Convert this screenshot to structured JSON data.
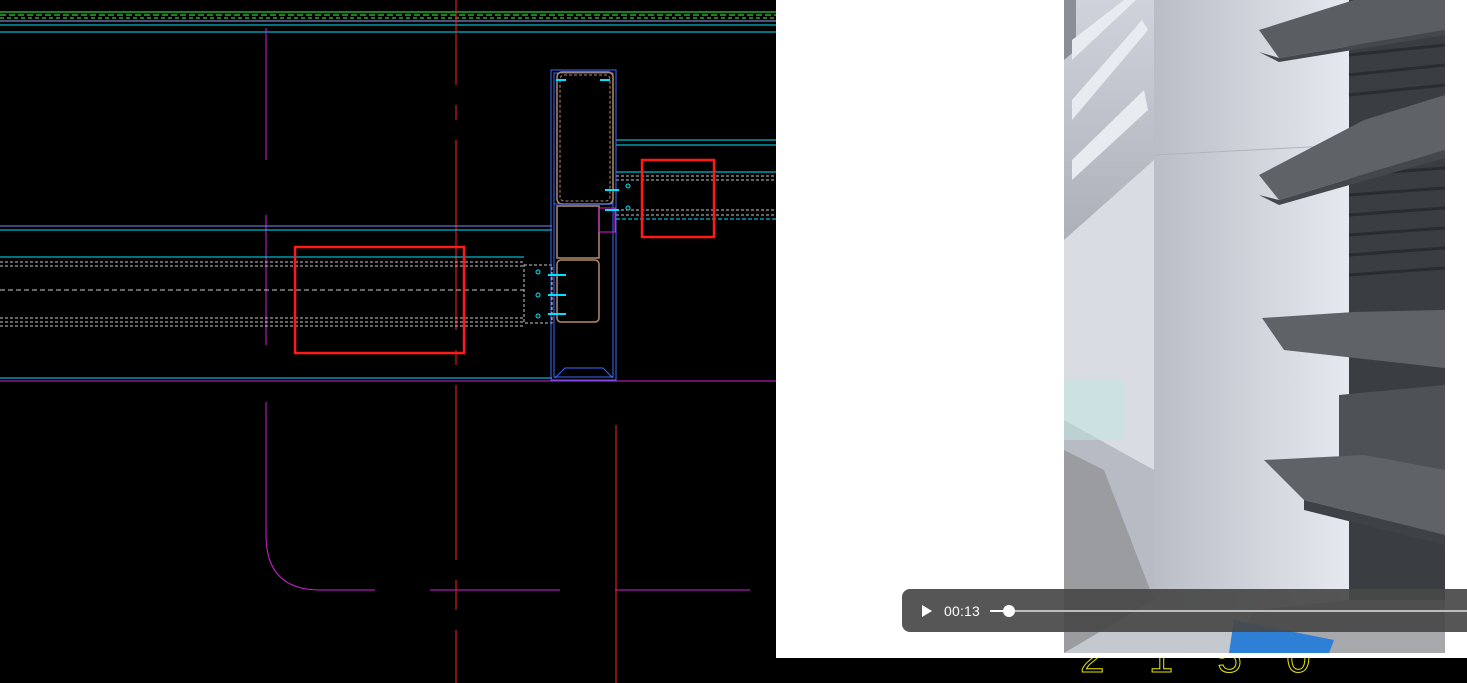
{
  "colors": {
    "cad_background": "#000000",
    "cad_cyan": "#00e5ff",
    "cad_green": "#3cff3c",
    "cad_red_axis": "#ff2020",
    "cad_magenta": "#d21edc",
    "cad_blue": "#3c6cff",
    "cad_profile": "#b48c6e",
    "markup_red": "#ff1a1a",
    "cad_yellow": "#e6e600",
    "panel_white": "#ffffff",
    "wall_white": "#dfe2e8",
    "louver_gray": "#5a5e63",
    "control_bar": "#484848"
  },
  "cad_drawing": {
    "bottom_text": "2 1 5 0"
  },
  "video_player": {
    "state": "paused",
    "play_icon": "play-icon",
    "time": "00:13",
    "progress_fraction": 0.04
  }
}
